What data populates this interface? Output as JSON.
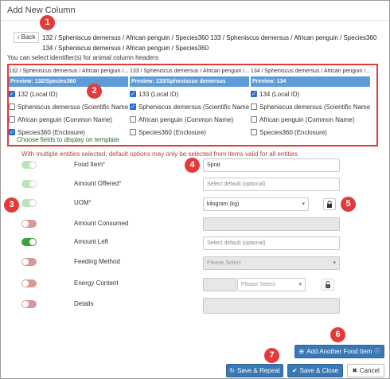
{
  "dialog": {
    "title": "Add New Column"
  },
  "nav": {
    "back_label": "Back",
    "breadcrumb": "132 / Spheniscus demersus / African penguin / Species360 133 / Spheniscus demersus / African penguin / Species360 134 / Spheniscus demersus / African penguin / Species360",
    "hint": "You can select identifier(s) for animal column headers"
  },
  "entities": [
    {
      "header": "132 / Spheniscus demersus / African penguin /...",
      "preview": "Preview: 132/Species360",
      "options": [
        {
          "label": "132 (Local ID)",
          "checked": true
        },
        {
          "label": "Spheniscus demersus (Scientific Name)",
          "checked": false
        },
        {
          "label": "African penguin (Common Name)",
          "checked": false
        },
        {
          "label": "Species360 (Enclosure)",
          "checked": true
        }
      ]
    },
    {
      "header": "133 / Spheniscus demersus / African penguin /...",
      "preview": "Preview: 133/Spheniscus demersus",
      "options": [
        {
          "label": "133 (Local ID)",
          "checked": true
        },
        {
          "label": "Spheniscus demersus (Scientific Name)",
          "checked": true
        },
        {
          "label": "African penguin (Common Name)",
          "checked": false
        },
        {
          "label": "Species360 (Enclosure)",
          "checked": false
        }
      ]
    },
    {
      "header": "134 / Spheniscus demersus / African penguin /...",
      "preview": "Preview: 134",
      "options": [
        {
          "label": "134 (Local ID)",
          "checked": true
        },
        {
          "label": "Spheniscus demersus (Scientific Name)",
          "checked": false
        },
        {
          "label": "African penguin (Common Name)",
          "checked": false
        },
        {
          "label": "Species360 (Enclosure)",
          "checked": false
        }
      ]
    }
  ],
  "choose_hint": "Choose fields to display on template",
  "warning": "With multiple entities selected, default options may only be selected from items valid for all entities",
  "fields": [
    {
      "label": "Food Item",
      "required": "*",
      "enabled": true,
      "value": "Sprat",
      "placeholder": ""
    },
    {
      "label": "Amount Offered",
      "required": "*",
      "enabled": true,
      "value": "",
      "placeholder": "Select default (optional)"
    },
    {
      "label": "UOM",
      "required": "*",
      "enabled": true,
      "value": "kilogram (kg)",
      "placeholder": ""
    },
    {
      "label": "Amount Consumed",
      "required": "",
      "enabled": false,
      "value": "",
      "placeholder": ""
    },
    {
      "label": "Amount Left",
      "required": "",
      "enabled": true,
      "value": "",
      "placeholder": "Select default (optional)"
    },
    {
      "label": "Feeding Method",
      "required": "",
      "enabled": false,
      "value": "",
      "placeholder": "Please Select"
    },
    {
      "label": "Energy Content",
      "required": "",
      "enabled": false,
      "value": "",
      "placeholder": "Please Select"
    },
    {
      "label": "Details",
      "required": "",
      "enabled": false,
      "value": "",
      "placeholder": ""
    }
  ],
  "markers": [
    "1",
    "2",
    "3",
    "4",
    "5",
    "6",
    "7"
  ],
  "buttons": {
    "add_food_item": "Add Another Food Item",
    "save_repeat": "Save & Repeat",
    "save_close": "Save & Close",
    "cancel": "Cancel"
  },
  "colors": {
    "accent_blue": "#3a78b4",
    "preview_blue": "#5e9cd8",
    "marker_red": "#e23b3b",
    "toggle_on": "#3aa43a",
    "toggle_off": "#d79a9a"
  }
}
